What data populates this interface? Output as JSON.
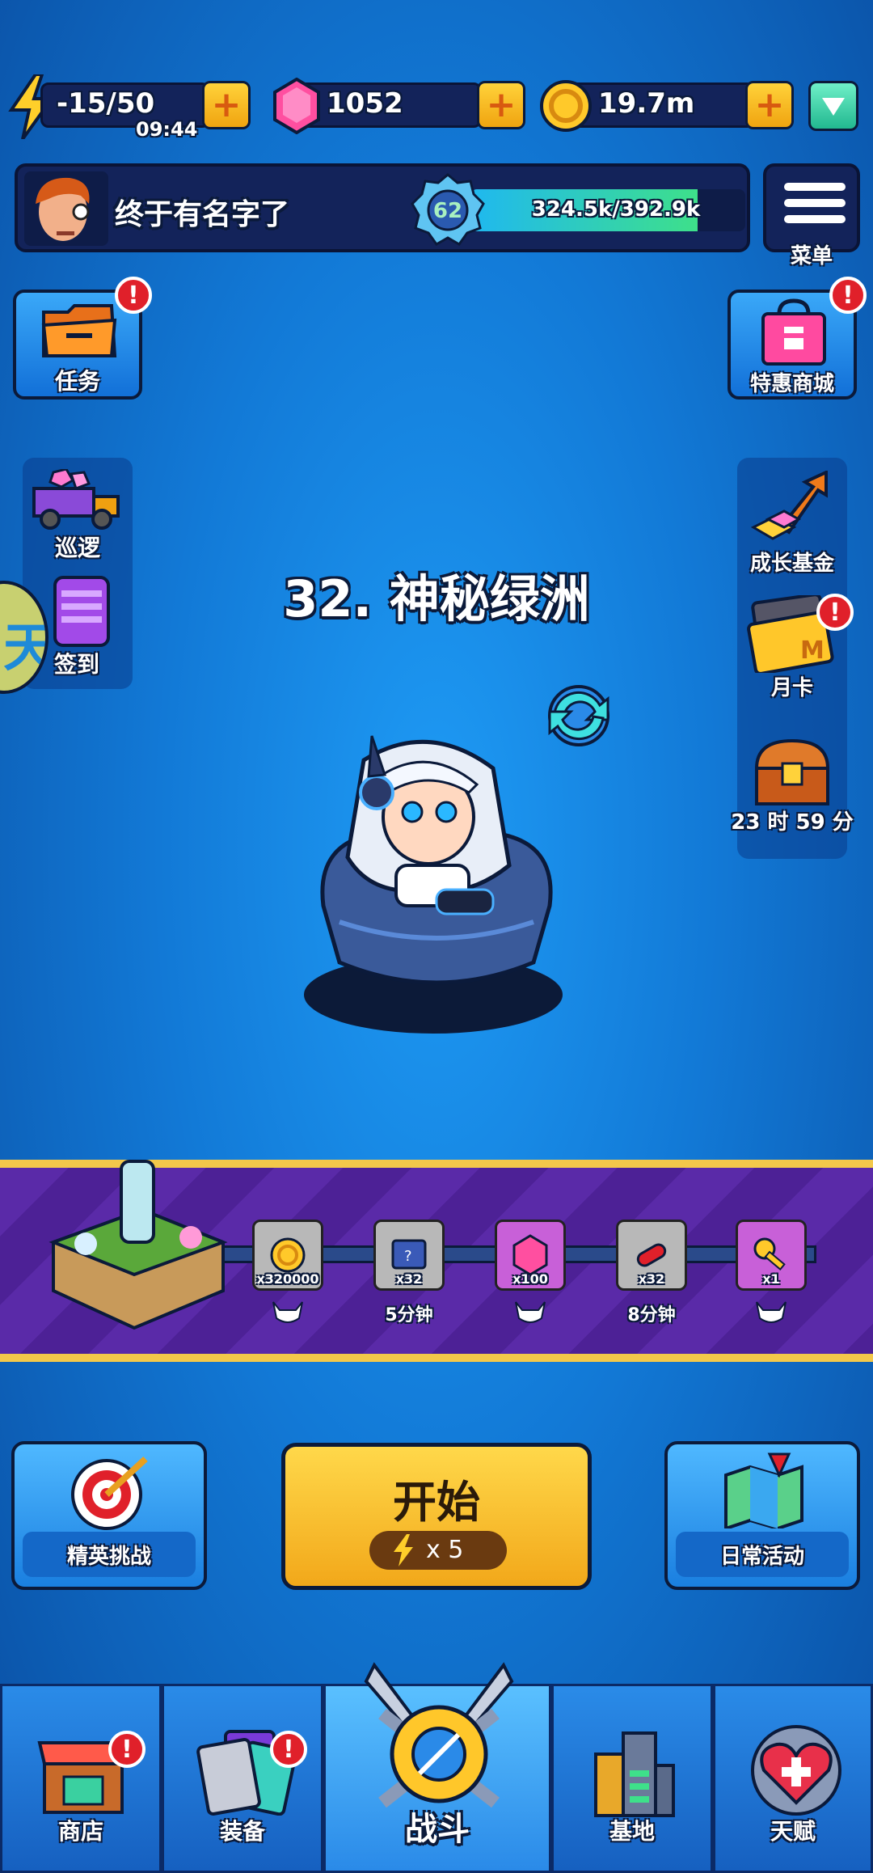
{
  "resources": {
    "energy": "-15/50",
    "energy_timer": "09:44",
    "gems": "1052",
    "coins": "19.7m"
  },
  "profile": {
    "name": "终于有名字了",
    "level": "62",
    "xp_text": "324.5k/392.9k",
    "xp_progress": 0.826
  },
  "menu_label": "菜单",
  "left_side": {
    "tasks": "任务",
    "patrol": "巡逻",
    "checkin": "签到",
    "edge_glyph": "天"
  },
  "right_side": {
    "shop_special": "特惠商城",
    "growth_fund": "成长基金",
    "month_card": "月卡",
    "chest_timer": "23 时 59 分"
  },
  "stage_title": "32. 神秘绿洲",
  "rewards": [
    {
      "count": "x320000",
      "label": "",
      "kind": "coin"
    },
    {
      "count": "x32",
      "label": "5分钟",
      "kind": "ticket"
    },
    {
      "count": "x100",
      "label": "",
      "kind": "gem"
    },
    {
      "count": "x32",
      "label": "8分钟",
      "kind": "pill"
    },
    {
      "count": "x1",
      "label": "",
      "kind": "key"
    }
  ],
  "buttons": {
    "elite": "精英挑战",
    "start": "开始",
    "start_cost": "x 5",
    "daily": "日常活动"
  },
  "nav": {
    "shop": "商店",
    "equip": "装备",
    "battle": "战斗",
    "base": "基地",
    "talent": "天赋"
  },
  "colors": {
    "accent_yellow": "#f2a81a",
    "badge_red": "#e0202a",
    "strip_purple": "#5a2aa8",
    "xp_green": "#3ee08a"
  }
}
